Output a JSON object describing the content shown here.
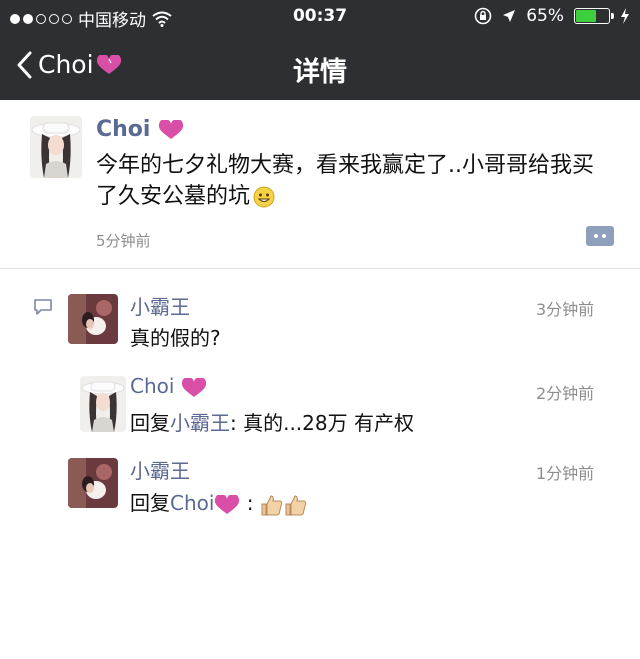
{
  "status": {
    "carrier": "中国移动",
    "time": "00:37",
    "battery": "65%",
    "battery_level": 0.65,
    "signal_dots_filled": 2,
    "signal_dots_total": 5
  },
  "nav": {
    "back_label": "Choi",
    "title": "详情"
  },
  "post": {
    "author": "Choi",
    "text": "今年的七夕礼物大赛，看来我赢定了..小哥哥给我买了久安公墓的坑",
    "time": "5分钟前"
  },
  "comments": [
    {
      "author": "小霸王",
      "text": "真的假的?",
      "time": "3分钟前"
    },
    {
      "author": "Choi",
      "reply_prefix": "回复",
      "reply_to": "小霸王",
      "text": ": 真的...28万 有产权",
      "time": "2分钟前"
    },
    {
      "author": "小霸王",
      "reply_prefix": "回复",
      "reply_to": "Choi",
      "text": " : ",
      "time": "1分钟前"
    }
  ],
  "colors": {
    "nav_bg": "#2e2f33",
    "name_link": "#5b6a92",
    "battery_fill": "#3ecf3e"
  }
}
